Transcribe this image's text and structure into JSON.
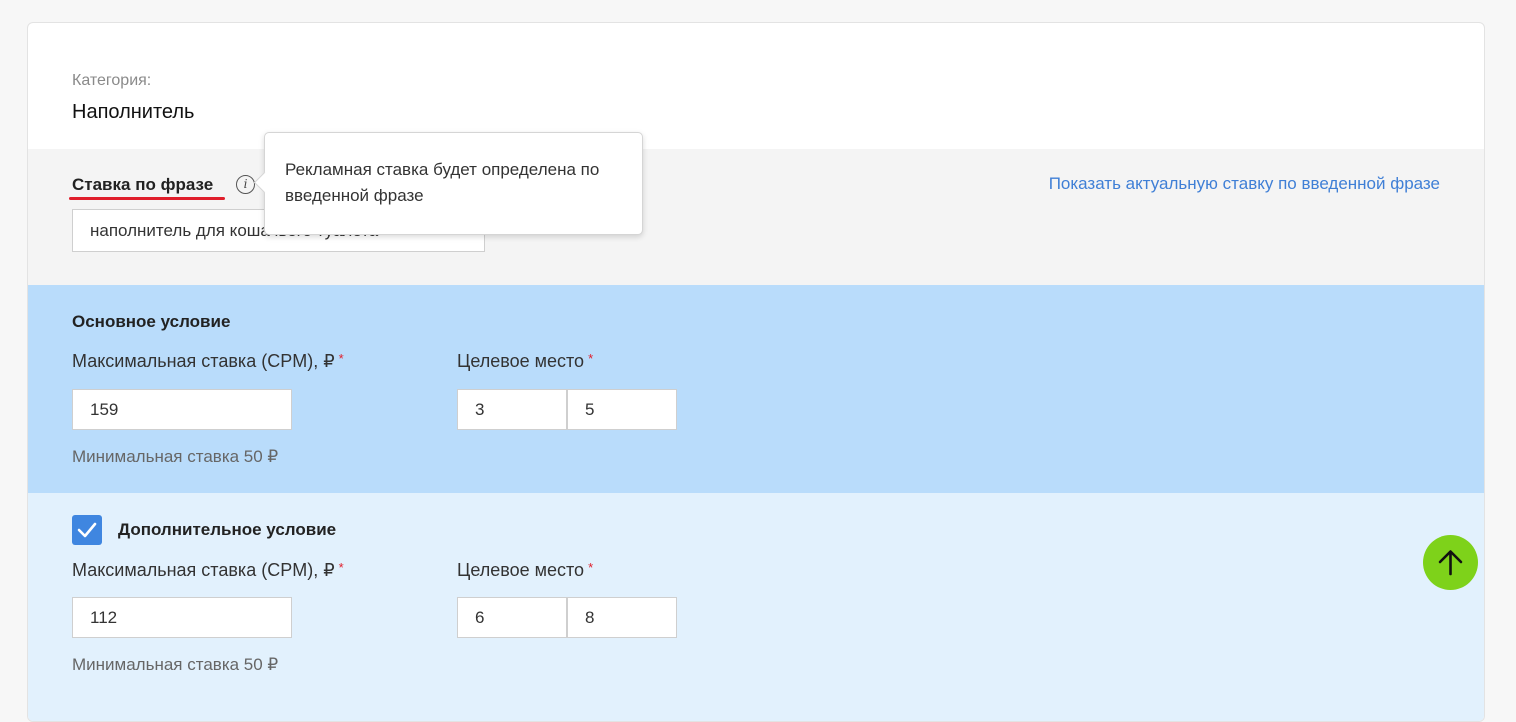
{
  "category": {
    "label": "Категория:",
    "value": "Наполнитель"
  },
  "phrase": {
    "title": "Ставка по фразе",
    "input_value": "наполнитель для кошачьего туалета",
    "show_link": "Показать актуальную ставку по введенной фразе",
    "tooltip": "Рекламная ставка будет определена по введенной фразе",
    "info_icon": "info-icon"
  },
  "main_condition": {
    "title": "Основное условие",
    "max_bid_label": "Максимальная ставка (CPM), ₽",
    "target_label": "Целевое место",
    "required_mark": "*",
    "max_bid_value": "159",
    "target_from": "3",
    "target_to": "5",
    "min_bid_hint": "Минимальная ставка 50 ₽"
  },
  "extra_condition": {
    "title": "Дополнительное условие",
    "checked": true,
    "max_bid_label": "Максимальная ставка (CPM), ₽",
    "target_label": "Целевое место",
    "required_mark": "*",
    "max_bid_value": "112",
    "target_from": "6",
    "target_to": "8",
    "min_bid_hint": "Минимальная ставка 50 ₽"
  },
  "scroll_top": {
    "icon": "arrow-up-icon",
    "color": "#7ed21a"
  },
  "colors": {
    "main_condition_bg": "#b9dcfb",
    "extra_condition_bg": "#e2f1fd",
    "link": "#3f7fd6",
    "required": "#e01e2b",
    "checkbox": "#3f86e0"
  }
}
